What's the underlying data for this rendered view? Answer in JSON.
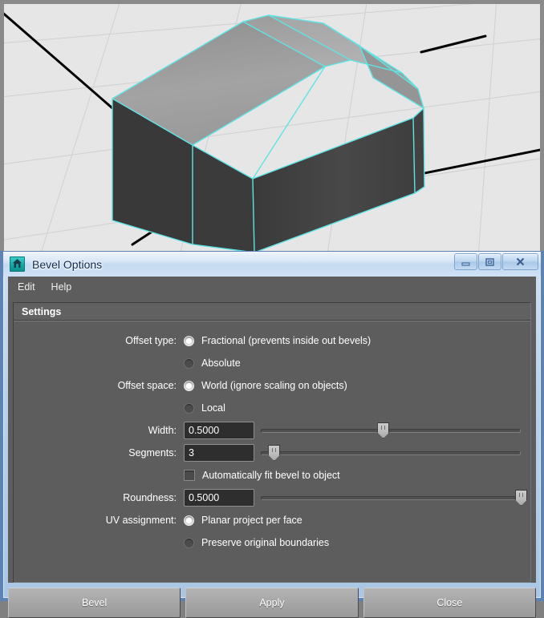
{
  "viewport": {
    "name": "maya-3d-viewport",
    "background_color": "#e6e6e6",
    "grid_color": "#cfcfcf",
    "axis_color": "#000000",
    "selection_outline_color": "#5fe4e4",
    "object": "beveled-cube",
    "face_top_color": "#9c9c9c",
    "face_left_color": "#3a3a3a",
    "face_right_color": "#3f3f3f"
  },
  "window": {
    "title": "Bevel Options",
    "icon": "maya-app-icon",
    "controls": {
      "minimize": "minimize-icon",
      "maximize": "maximize-icon",
      "close": "close-icon"
    }
  },
  "menubar": {
    "items": [
      {
        "label": "Edit"
      },
      {
        "label": "Help"
      }
    ]
  },
  "settings": {
    "header": "Settings",
    "offset_type": {
      "label": "Offset type:",
      "options": [
        {
          "label": "Fractional (prevents inside out bevels)",
          "selected": true
        },
        {
          "label": "Absolute",
          "selected": false
        }
      ]
    },
    "offset_space": {
      "label": "Offset space:",
      "options": [
        {
          "label": "World (ignore scaling on objects)",
          "selected": true
        },
        {
          "label": "Local",
          "selected": false
        }
      ]
    },
    "width": {
      "label": "Width:",
      "value": "0.5000",
      "slider_percent": 47
    },
    "segments": {
      "label": "Segments:",
      "value": "3",
      "slider_percent": 5
    },
    "auto_fit": {
      "label": "Automatically fit bevel to object",
      "checked": false
    },
    "roundness": {
      "label": "Roundness:",
      "value": "0.5000",
      "slider_percent": 100
    },
    "uv_assignment": {
      "label": "UV assignment:",
      "options": [
        {
          "label": "Planar project per face",
          "selected": true
        },
        {
          "label": "Preserve original boundaries",
          "selected": false
        }
      ]
    }
  },
  "buttons": [
    {
      "label": "Bevel"
    },
    {
      "label": "Apply"
    },
    {
      "label": "Close"
    }
  ]
}
